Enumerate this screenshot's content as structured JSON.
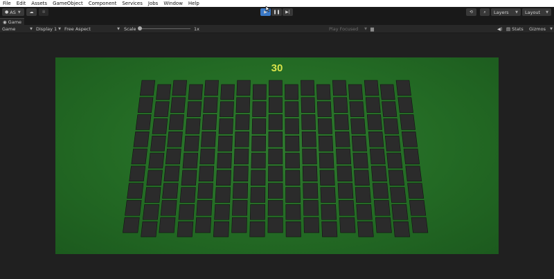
{
  "menu": [
    "File",
    "Edit",
    "Assets",
    "GameObject",
    "Component",
    "Services",
    "Jobs",
    "Window",
    "Help"
  ],
  "toolbar": {
    "account": "AS",
    "layers": "Layers",
    "layout": "Layout"
  },
  "tabs": {
    "game": "Game"
  },
  "gamebar": {
    "display_mode": "Game",
    "display": "Display 1",
    "aspect": "Free Aspect",
    "scale_label": "Scale",
    "scale_value": "1x",
    "play_focused": "Play Focused",
    "stats": "Stats",
    "gizmos": "Gizmos"
  },
  "game": {
    "score": "30",
    "grid_rows": 9,
    "grid_cols": 17
  },
  "colors": {
    "background_green": "#236a24",
    "score_color": "#d8e34a",
    "tile_color": "#2b2b2b",
    "play_active": "#3a79c7"
  }
}
